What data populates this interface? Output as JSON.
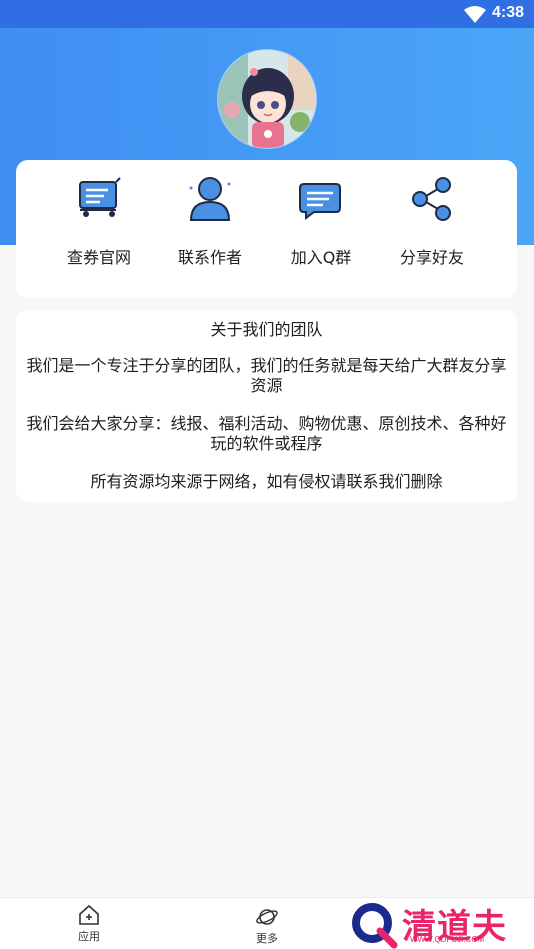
{
  "status_bar": {
    "time": "4:38"
  },
  "menu": [
    {
      "label": "查券官网",
      "icon": "cart-icon"
    },
    {
      "label": "联系作者",
      "icon": "person-icon"
    },
    {
      "label": "加入Q群",
      "icon": "chat-bubble-icon"
    },
    {
      "label": "分享好友",
      "icon": "share-icon"
    }
  ],
  "about": {
    "title": "关于我们的团队",
    "p1": "我们是一个专注于分享的团队，我们的任务就是每天给广大群友分享资源",
    "p2": "我们会给大家分享：线报、福利活动、购物优惠、原创技术、各种好玩的软件或程序",
    "p3": "所有资源均来源于网络，如有侵权请联系我们删除"
  },
  "bottom_nav": [
    {
      "label": "应用",
      "icon": "home-icon"
    },
    {
      "label": "更多",
      "icon": "planet-icon"
    }
  ],
  "watermark": {
    "text": "清道夫",
    "sub": "WWW.QDFUJI.COM"
  },
  "colors": {
    "header": "#3f8ef2",
    "accent": "#4a90e2",
    "watermark": "#e8246a"
  }
}
